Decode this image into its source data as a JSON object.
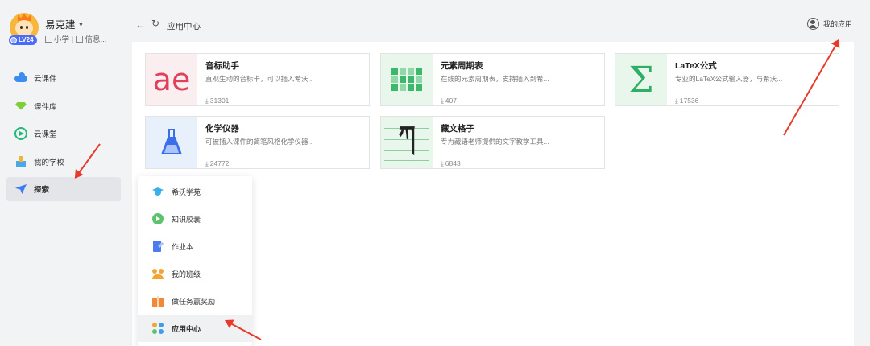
{
  "user": {
    "name": "易克建",
    "level": "LV24",
    "school_type": "小学",
    "info_label": "信息..."
  },
  "sidebar": {
    "items": [
      {
        "label": "云课件",
        "icon": "cloud-icon"
      },
      {
        "label": "课件库",
        "icon": "gem-icon"
      },
      {
        "label": "云课堂",
        "icon": "play-circle-icon"
      },
      {
        "label": "我的学校",
        "icon": "school-icon"
      },
      {
        "label": "探索",
        "icon": "rocket-icon",
        "active": true
      }
    ]
  },
  "header": {
    "title": "应用中心",
    "my_apps_label": "我的应用"
  },
  "apps": [
    {
      "title": "音标助手",
      "desc": "直观生动的音标卡，可以插入希沃...",
      "count": "31301",
      "thumb": "ae"
    },
    {
      "title": "元素周期表",
      "desc": "在线的元素周期表，支持插入到希...",
      "count": "407",
      "thumb": "grid-icon"
    },
    {
      "title": "LaTeX公式",
      "desc": "专业的LaTeX公式输入器，与希沃...",
      "count": "17536",
      "thumb": "Σ"
    },
    {
      "title": "化学仪器",
      "desc": "可被插入课件的简笔风格化学仪器...",
      "count": "24772",
      "thumb": "flask-icon"
    },
    {
      "title": "藏文格子",
      "desc": "专为藏语老师提供的文字教学工具...",
      "count": "6843",
      "thumb": "ཀ"
    }
  ],
  "menu": {
    "items": [
      {
        "label": "希沃学苑",
        "icon": "graduation-cap-icon"
      },
      {
        "label": "知识胶囊",
        "icon": "capsule-play-icon"
      },
      {
        "label": "作业本",
        "icon": "homework-book-icon"
      },
      {
        "label": "我的班级",
        "icon": "class-people-icon"
      },
      {
        "label": "做任务赢奖励",
        "icon": "gift-icon"
      },
      {
        "label": "应用中心",
        "icon": "app-center-icon",
        "active": true
      }
    ]
  },
  "colors": {
    "accent_blue": "#3b6ee8",
    "annotation_red": "#e83a2a",
    "green": "#3cb86a"
  }
}
